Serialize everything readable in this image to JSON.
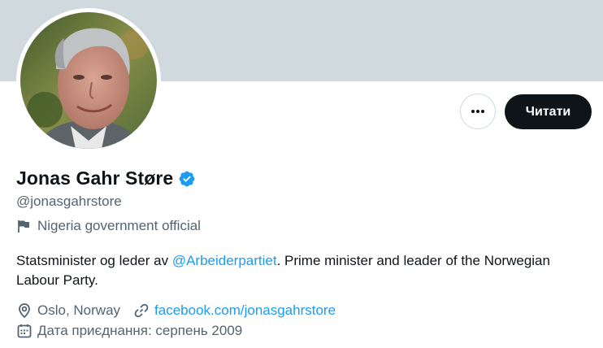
{
  "profile": {
    "name": "Jonas Gahr Støre",
    "handle": "@jonasgahrstore",
    "category": "Nigeria government official",
    "bio_before": "Statsminister og leder av ",
    "bio_mention": "@Arbeiderpartiet",
    "bio_after": ". Prime minister and leader of the Norwegian Labour Party.",
    "location": "Oslo, Norway",
    "website": "facebook.com/jonasgahrstore",
    "joined": "Дата приєднання: серпень 2009"
  },
  "actions": {
    "follow_label": "Читати",
    "more_icon": "more-horizontal-icon"
  },
  "colors": {
    "banner": "#cfd9de",
    "accent": "#1d9bf0",
    "secondary_text": "#536471",
    "primary_text": "#0f1419"
  }
}
